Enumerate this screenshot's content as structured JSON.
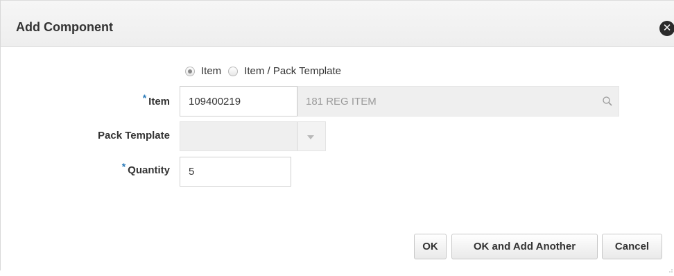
{
  "dialog": {
    "title": "Add Component",
    "close_icon": "close-icon"
  },
  "type_selector": {
    "options": [
      {
        "label": "Item",
        "selected": true
      },
      {
        "label": "Item / Pack Template",
        "selected": false
      }
    ]
  },
  "fields": {
    "item": {
      "label": "Item",
      "required_marker": "*",
      "value": "109400219",
      "description": "181 REG ITEM",
      "search_icon": "search-icon"
    },
    "pack_template": {
      "label": "Pack Template",
      "value": "",
      "dropdown_icon": "chevron-down-icon"
    },
    "quantity": {
      "label": "Quantity",
      "required_marker": "*",
      "value": "5"
    }
  },
  "buttons": {
    "ok": "OK",
    "ok_and_add_another": "OK and Add Another",
    "cancel": "Cancel"
  },
  "colors": {
    "required_marker": "#2a7ab9",
    "header_background": "#f1f1f1",
    "readonly_background": "#efefef"
  }
}
